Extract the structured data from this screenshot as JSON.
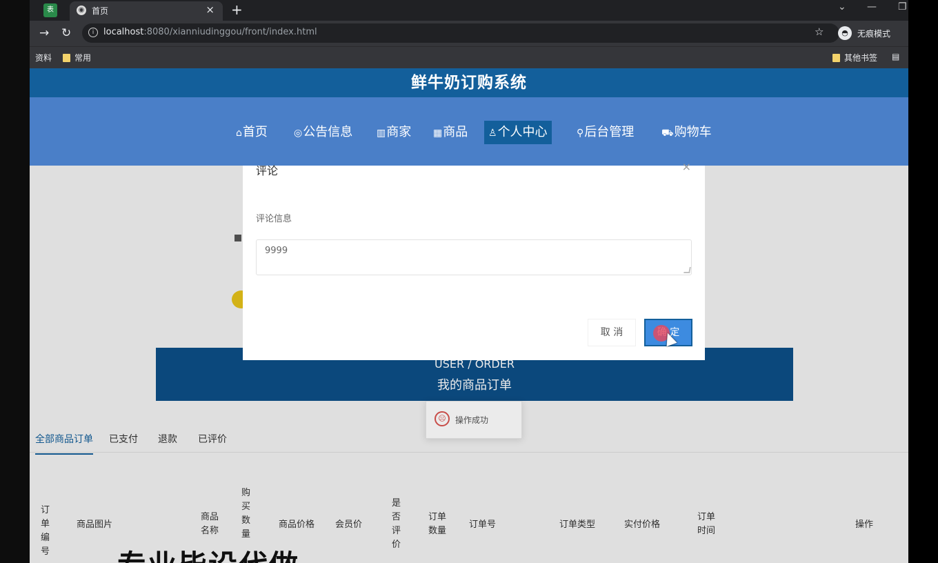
{
  "browser": {
    "tab_title": "首页",
    "url_host": "localhost",
    "url_path": ":8080/xianniudinggou/front/index.html",
    "incognito_label": "无痕模式",
    "bookmarks": [
      {
        "label": "资料"
      },
      {
        "label": "常用"
      }
    ],
    "other_bookmarks": "其他书签"
  },
  "site": {
    "title": "鲜牛奶订购系统",
    "nav": [
      {
        "label": "首页",
        "icon": "⌂",
        "active": false
      },
      {
        "label": "公告信息",
        "icon": "◎",
        "active": false
      },
      {
        "label": "商家",
        "icon": "▥",
        "active": false
      },
      {
        "label": "商品",
        "icon": "▦",
        "active": false
      },
      {
        "label": "个人中心",
        "icon": "♙",
        "active": true
      },
      {
        "label": "后台管理",
        "icon": "⚲",
        "active": false
      },
      {
        "label": "购物车",
        "icon": "⛟",
        "active": false
      }
    ]
  },
  "banner": {
    "en": "USER / ORDER",
    "zh": "我的商品订单"
  },
  "toast": {
    "message": "操作成功"
  },
  "order_tabs": [
    {
      "label": "全部商品订单",
      "active": true
    },
    {
      "label": "已支付",
      "active": false
    },
    {
      "label": "退款",
      "active": false
    },
    {
      "label": "已评价",
      "active": false
    }
  ],
  "table_headers": [
    "订单编号",
    "商品图片",
    "商品名称",
    "购买数量",
    "商品价格",
    "会员价",
    "是否评价",
    "订单数量",
    "订单号",
    "订单类型",
    "实付价格",
    "订单时间",
    "操作"
  ],
  "watermark": "专业毕设代做",
  "modal": {
    "title": "评论",
    "close": "×",
    "field_label": "评论信息",
    "textarea_value": "9999",
    "cancel_label": "取 消",
    "ok_label": "确 定"
  },
  "colors": {
    "header_bg": "#135f9b",
    "nav_bg": "#4a7fc8",
    "primary_button": "#3d8be0"
  }
}
